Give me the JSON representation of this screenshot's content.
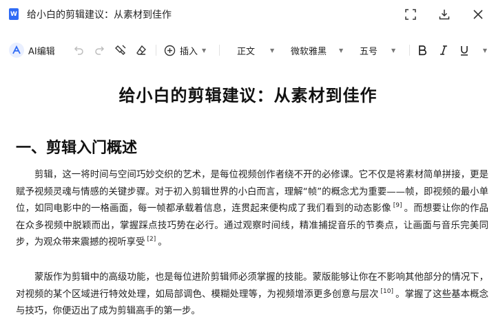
{
  "window": {
    "app_icon_letter": "W",
    "title": "给小白的剪辑建议：从素材到佳作"
  },
  "toolbar": {
    "ai_label": "AI编辑",
    "insert_label": "插入",
    "style_value": "正文",
    "font_value": "微软雅黑",
    "size_value": "五号"
  },
  "document": {
    "title": "给小白的剪辑建议：从素材到佳作",
    "heading": "一、剪辑入门概述",
    "para1": {
      "text1": "剪辑，这一将时间与空间巧妙交织的艺术，是每位视频创作者绕不开的必修课。它不仅是将素材简单拼接，更是赋予视频灵魂与情感的关键步骤。对于初入剪辑世界的小白而言，理解“帧”的概念尤为重要——帧，即视频的最小单位，如同电影中的一格画面，每一帧都承载着信息，连贯起来便构成了我们看到的动态影像",
      "ref1": "[9]",
      "text2": "。而想要让你的作品在众多视频中脱颖而出，掌握踩点技巧势在必行。通过观察时间线，精准捕捉音乐的节奏点，让画面与音乐完美同步，为观众带来震撼的视听享受",
      "ref2": "[2]",
      "text3": "。"
    },
    "para2": {
      "text1": "蒙版作为剪辑中的高级功能，也是每位进阶剪辑师必须掌握的技能。蒙版能够让你在不影响其他部分的情况下，对视频的某个区域进行特效处理，如局部调色、模糊处理等，为视频增添更多创意与层次",
      "ref1": "[10]",
      "text2": "。掌握了这些基本概念与技巧，你便迈出了成为剪辑高手的第一步。"
    }
  }
}
